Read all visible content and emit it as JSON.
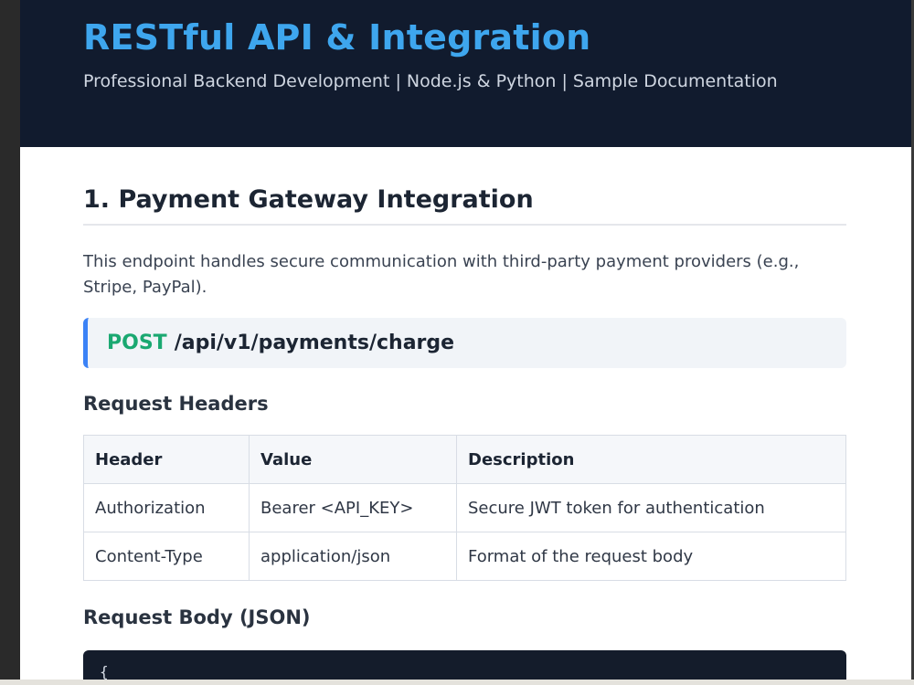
{
  "header": {
    "title": "RESTful API & Integration",
    "subtitle": "Professional Backend Development | Node.js & Python | Sample Documentation"
  },
  "section": {
    "title": "1. Payment Gateway Integration",
    "description": "This endpoint handles secure communication with third-party payment providers (e.g., Stripe, PayPal)."
  },
  "endpoint": {
    "method": "POST",
    "path": "/api/v1/payments/charge"
  },
  "request_headers": {
    "heading": "Request Headers",
    "columns": [
      "Header",
      "Value",
      "Description"
    ],
    "rows": [
      [
        "Authorization",
        "Bearer <API_KEY>",
        "Secure JWT token for authentication"
      ],
      [
        "Content-Type",
        "application/json",
        "Format of the request body"
      ]
    ]
  },
  "request_body": {
    "heading": "Request Body (JSON)",
    "code_first_line": "{"
  },
  "colors": {
    "header_bg": "#111b2e",
    "title_blue": "#3ea6ee",
    "method_green": "#1aa871",
    "endpoint_border": "#3b82f6"
  }
}
